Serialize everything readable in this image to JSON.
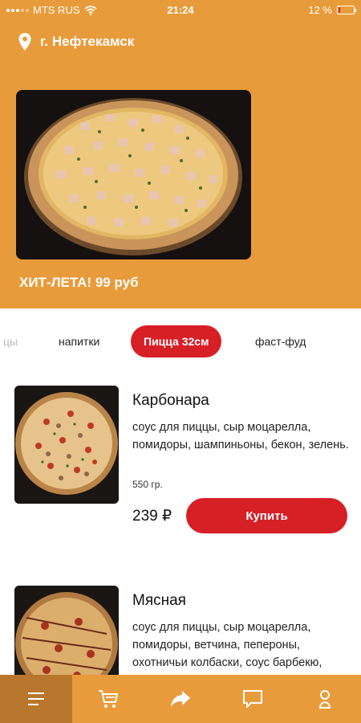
{
  "status_bar": {
    "carrier": "MTS RUS",
    "time": "21:24",
    "battery_text": "12 %",
    "battery_level": 0.12
  },
  "location": {
    "city": "г. Нефтекамск",
    "icon": "location-pin-icon"
  },
  "banner": {
    "title": "ХИТ-ЛЕТА! 99 руб"
  },
  "categories": [
    {
      "label": "цы",
      "state": "faded"
    },
    {
      "label": "напитки",
      "state": "normal"
    },
    {
      "label": "Пицца 32см",
      "state": "active"
    },
    {
      "label": "фаст-фуд",
      "state": "normal"
    },
    {
      "label": "",
      "state": "faded"
    }
  ],
  "products": [
    {
      "name": "Карбонара",
      "description": "соус для пиццы, сыр моцарелла, помидоры, шампиньоны, бекон, зелень.",
      "weight": "550 гр.",
      "price": "239 ₽",
      "buy_label": "Купить"
    },
    {
      "name": "Мясная",
      "description": "соус для пиццы, сыр моцарелла, помидоры, ветчина, пепероны, охотничьи колбаски, соус барбекю, зелень.",
      "weight": "",
      "price": "",
      "buy_label": ""
    }
  ],
  "bottom_nav": [
    {
      "icon": "menu-icon",
      "active": true
    },
    {
      "icon": "cart-icon",
      "active": false
    },
    {
      "icon": "share-icon",
      "active": false
    },
    {
      "icon": "chat-icon",
      "active": false
    },
    {
      "icon": "profile-icon",
      "active": false
    }
  ],
  "colors": {
    "header_orange": "#E89B3A",
    "accent_red": "#D71F26",
    "nav_active": "#B8772C"
  }
}
